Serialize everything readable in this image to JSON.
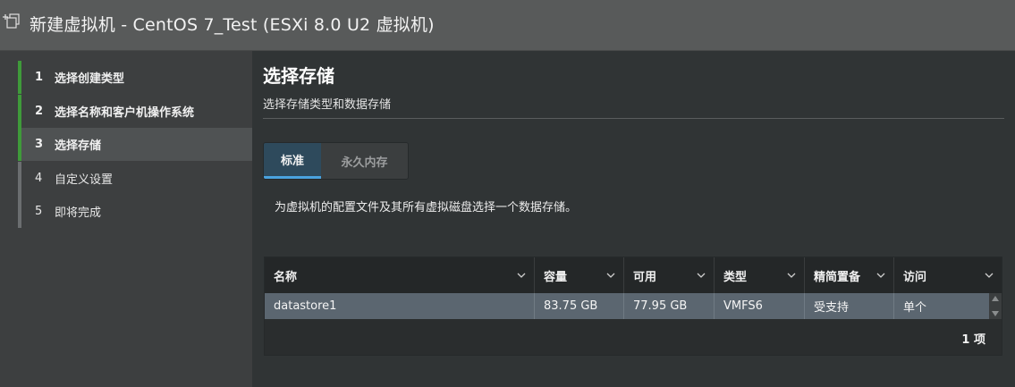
{
  "window": {
    "title": "新建虚拟机 - CentOS 7_Test (ESXi 8.0 U2 虚拟机)",
    "title_icon": "new-vm-icon"
  },
  "steps": [
    {
      "num": "1",
      "label": "选择创建类型",
      "state": "completed"
    },
    {
      "num": "2",
      "label": "选择名称和客户机操作系统",
      "state": "completed"
    },
    {
      "num": "3",
      "label": "选择存储",
      "state": "active"
    },
    {
      "num": "4",
      "label": "自定义设置",
      "state": "pending"
    },
    {
      "num": "5",
      "label": "即将完成",
      "state": "pending"
    }
  ],
  "page": {
    "title": "选择存储",
    "subtitle": "选择存储类型和数据存储",
    "description": "为虚拟机的配置文件及其所有虚拟磁盘选择一个数据存储。"
  },
  "tabs": [
    {
      "label": "标准",
      "selected": true
    },
    {
      "label": "永久内存",
      "selected": false
    }
  ],
  "grid": {
    "columns": [
      "名称",
      "容量",
      "可用",
      "类型",
      "精简置备",
      "访问"
    ],
    "rows": [
      [
        "datastore1",
        "83.75 GB",
        "77.95 GB",
        "VMFS6",
        "受支持",
        "单个"
      ]
    ],
    "footer": "1 项"
  },
  "colors": {
    "completed_step": "#3f9a3a",
    "pending_step": "#6b6e70",
    "selected_row": "#5b6670",
    "tab_accent": "#4aa3df"
  }
}
